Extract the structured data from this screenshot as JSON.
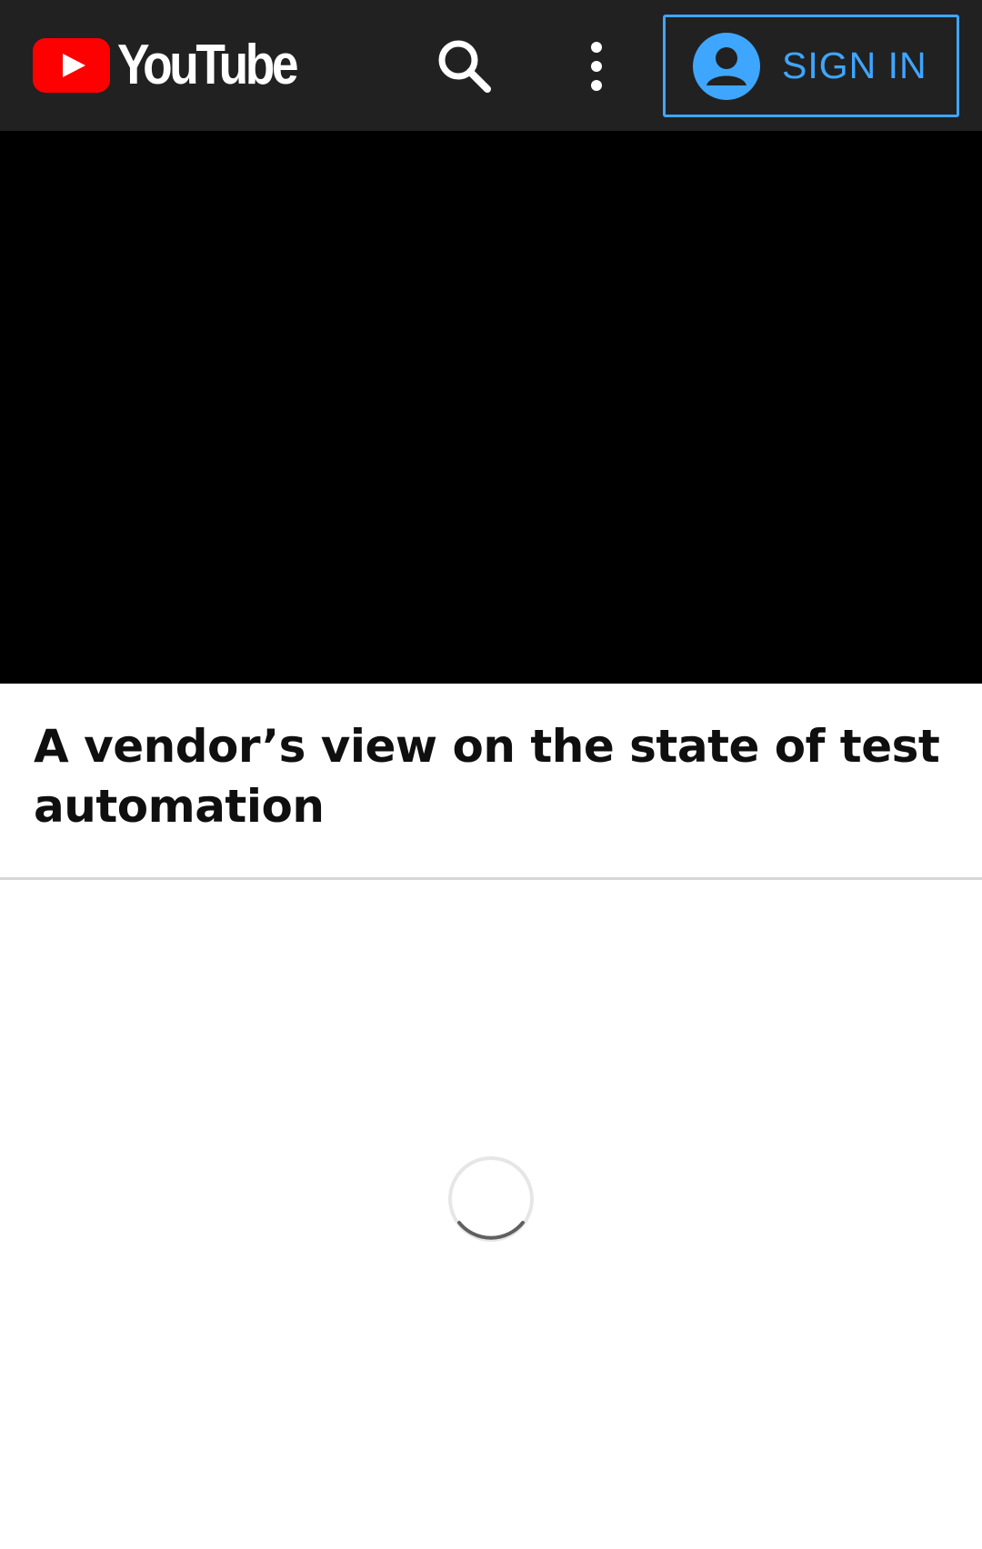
{
  "header": {
    "logo_text": "YouTube",
    "logo_color": "#ff0000",
    "search_icon": "search-icon",
    "more_icon": "more-vert-icon",
    "sign_in_label": "SIGN IN",
    "sign_in_color": "#3ea6ff"
  },
  "video": {
    "title": "A vendor’s view on the state of test automation"
  },
  "content": {
    "loading_indicator": "spinner-icon"
  }
}
